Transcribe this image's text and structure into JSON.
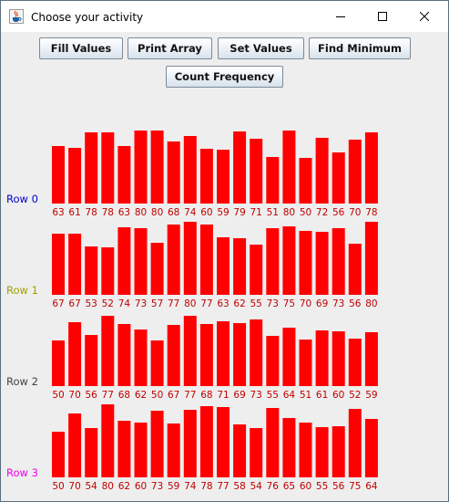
{
  "window": {
    "title": "Choose your activity"
  },
  "buttons": {
    "fill_values": "Fill Values",
    "print_array": "Print Array",
    "set_values": "Set Values",
    "find_minimum": "Find Minimum",
    "count_frequency": "Count Frequency"
  },
  "chart_data": {
    "type": "bar",
    "bar_color": "#ff0000",
    "value_label_color": "#c00000",
    "rows": [
      {
        "label": "Row 0",
        "label_color": "#0000cc",
        "values": [
          63,
          61,
          78,
          78,
          63,
          80,
          80,
          68,
          74,
          60,
          59,
          79,
          71,
          51,
          80,
          50,
          72,
          56,
          70,
          78
        ]
      },
      {
        "label": "Row 1",
        "label_color": "#a0a000",
        "values": [
          67,
          67,
          53,
          52,
          74,
          73,
          57,
          77,
          80,
          77,
          63,
          62,
          55,
          73,
          75,
          70,
          69,
          73,
          56,
          80
        ]
      },
      {
        "label": "Row 2",
        "label_color": "#444444",
        "values": [
          50,
          70,
          56,
          77,
          68,
          62,
          50,
          67,
          77,
          68,
          71,
          69,
          73,
          55,
          64,
          51,
          61,
          60,
          52,
          59
        ]
      },
      {
        "label": "Row 3",
        "label_color": "#ee00ee",
        "values": [
          50,
          70,
          54,
          80,
          62,
          60,
          73,
          59,
          74,
          78,
          77,
          58,
          54,
          76,
          65,
          60,
          55,
          56,
          75,
          64
        ]
      }
    ]
  }
}
